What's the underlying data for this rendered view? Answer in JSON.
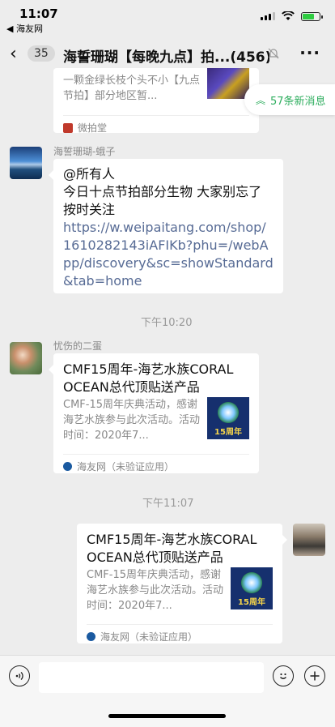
{
  "status": {
    "time": "11:07",
    "back_app": "◀ 海友网"
  },
  "nav": {
    "back": "‹",
    "unread": "35",
    "title": "海誓珊瑚【每晚九点】拍...(456)",
    "more": "···"
  },
  "new_msgs": "57条新消息",
  "messages": {
    "m0": {
      "desc": "一颗金绿长枝个头不小【九点节拍】部分地区暂...",
      "app": "微拍堂"
    },
    "m1": {
      "sender": "海誓珊瑚-蛾子",
      "text": "@所有人\n今日十点节拍部分生物 大家别忘了按时关注",
      "link": "https://w.weipaitang.com/shop/1610282143iAFIKb?phu=/webApp/discovery&sc=showStandard&tab=home"
    },
    "ts1": "下午10:20",
    "m2": {
      "sender": "忧伤的二蛋",
      "title": "CMF15周年-海艺水族CORAL OCEAN总代顶贴送产品",
      "desc": "CMF-15周年庆典活动，感谢海艺水族参与此次活动。活动时间：2020年7...",
      "app": "海友网（未验证应用）",
      "thumb_label": "15周年"
    },
    "ts2": "下午11:07",
    "m3": {
      "title": "CMF15周年-海艺水族CORAL OCEAN总代顶贴送产品",
      "desc": "CMF-15周年庆典活动，感谢海艺水族参与此次活动。活动时间：2020年7...",
      "app": "海友网（未验证应用）",
      "thumb_label": "15周年"
    }
  },
  "colors": {
    "accent": "#2fae5f",
    "link": "#576b95",
    "bg": "#ededed"
  }
}
